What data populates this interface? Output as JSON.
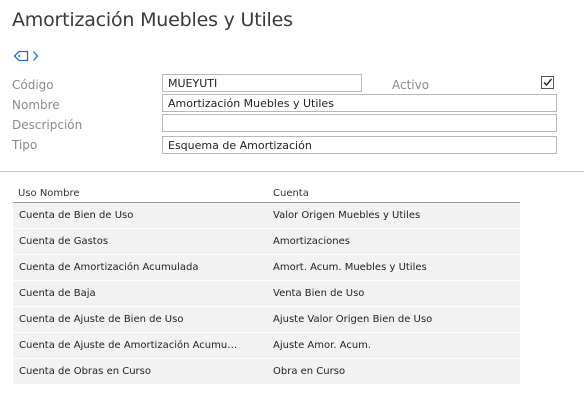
{
  "page": {
    "title": "Amortización Muebles y Utiles"
  },
  "icons": {
    "tag": "tag-icon",
    "chevron": "chevron-right-icon",
    "accent": "#1a6fc9"
  },
  "form": {
    "codigo_label": "Código",
    "codigo_value": "MUEYUTI",
    "nombre_label": "Nombre",
    "nombre_value": "Amortización Muebles y Utiles",
    "descripcion_label": "Descripción",
    "descripcion_value": "",
    "tipo_label": "Tipo",
    "tipo_value": "Esquema de Amortización",
    "activo_label": "Activo",
    "activo_checked": true
  },
  "grid": {
    "headers": [
      "Uso Nombre",
      "Cuenta"
    ],
    "rows": [
      [
        "Cuenta de Bien de Uso",
        "Valor Origen Muebles y Utiles"
      ],
      [
        "Cuenta de Gastos",
        "Amortizaciones"
      ],
      [
        "Cuenta de Amortización Acumulada",
        "Amort. Acum. Muebles y Utiles"
      ],
      [
        "Cuenta de Baja",
        "Venta Bien de Uso"
      ],
      [
        "Cuenta de Ajuste de Bien de Uso",
        "Ajuste Valor Origen Bien de Uso"
      ],
      [
        "Cuenta de Ajuste de Amortización Acumu…",
        "Ajuste Amor. Acum."
      ],
      [
        "Cuenta de Obras en Curso",
        "Obra en Curso"
      ]
    ]
  }
}
